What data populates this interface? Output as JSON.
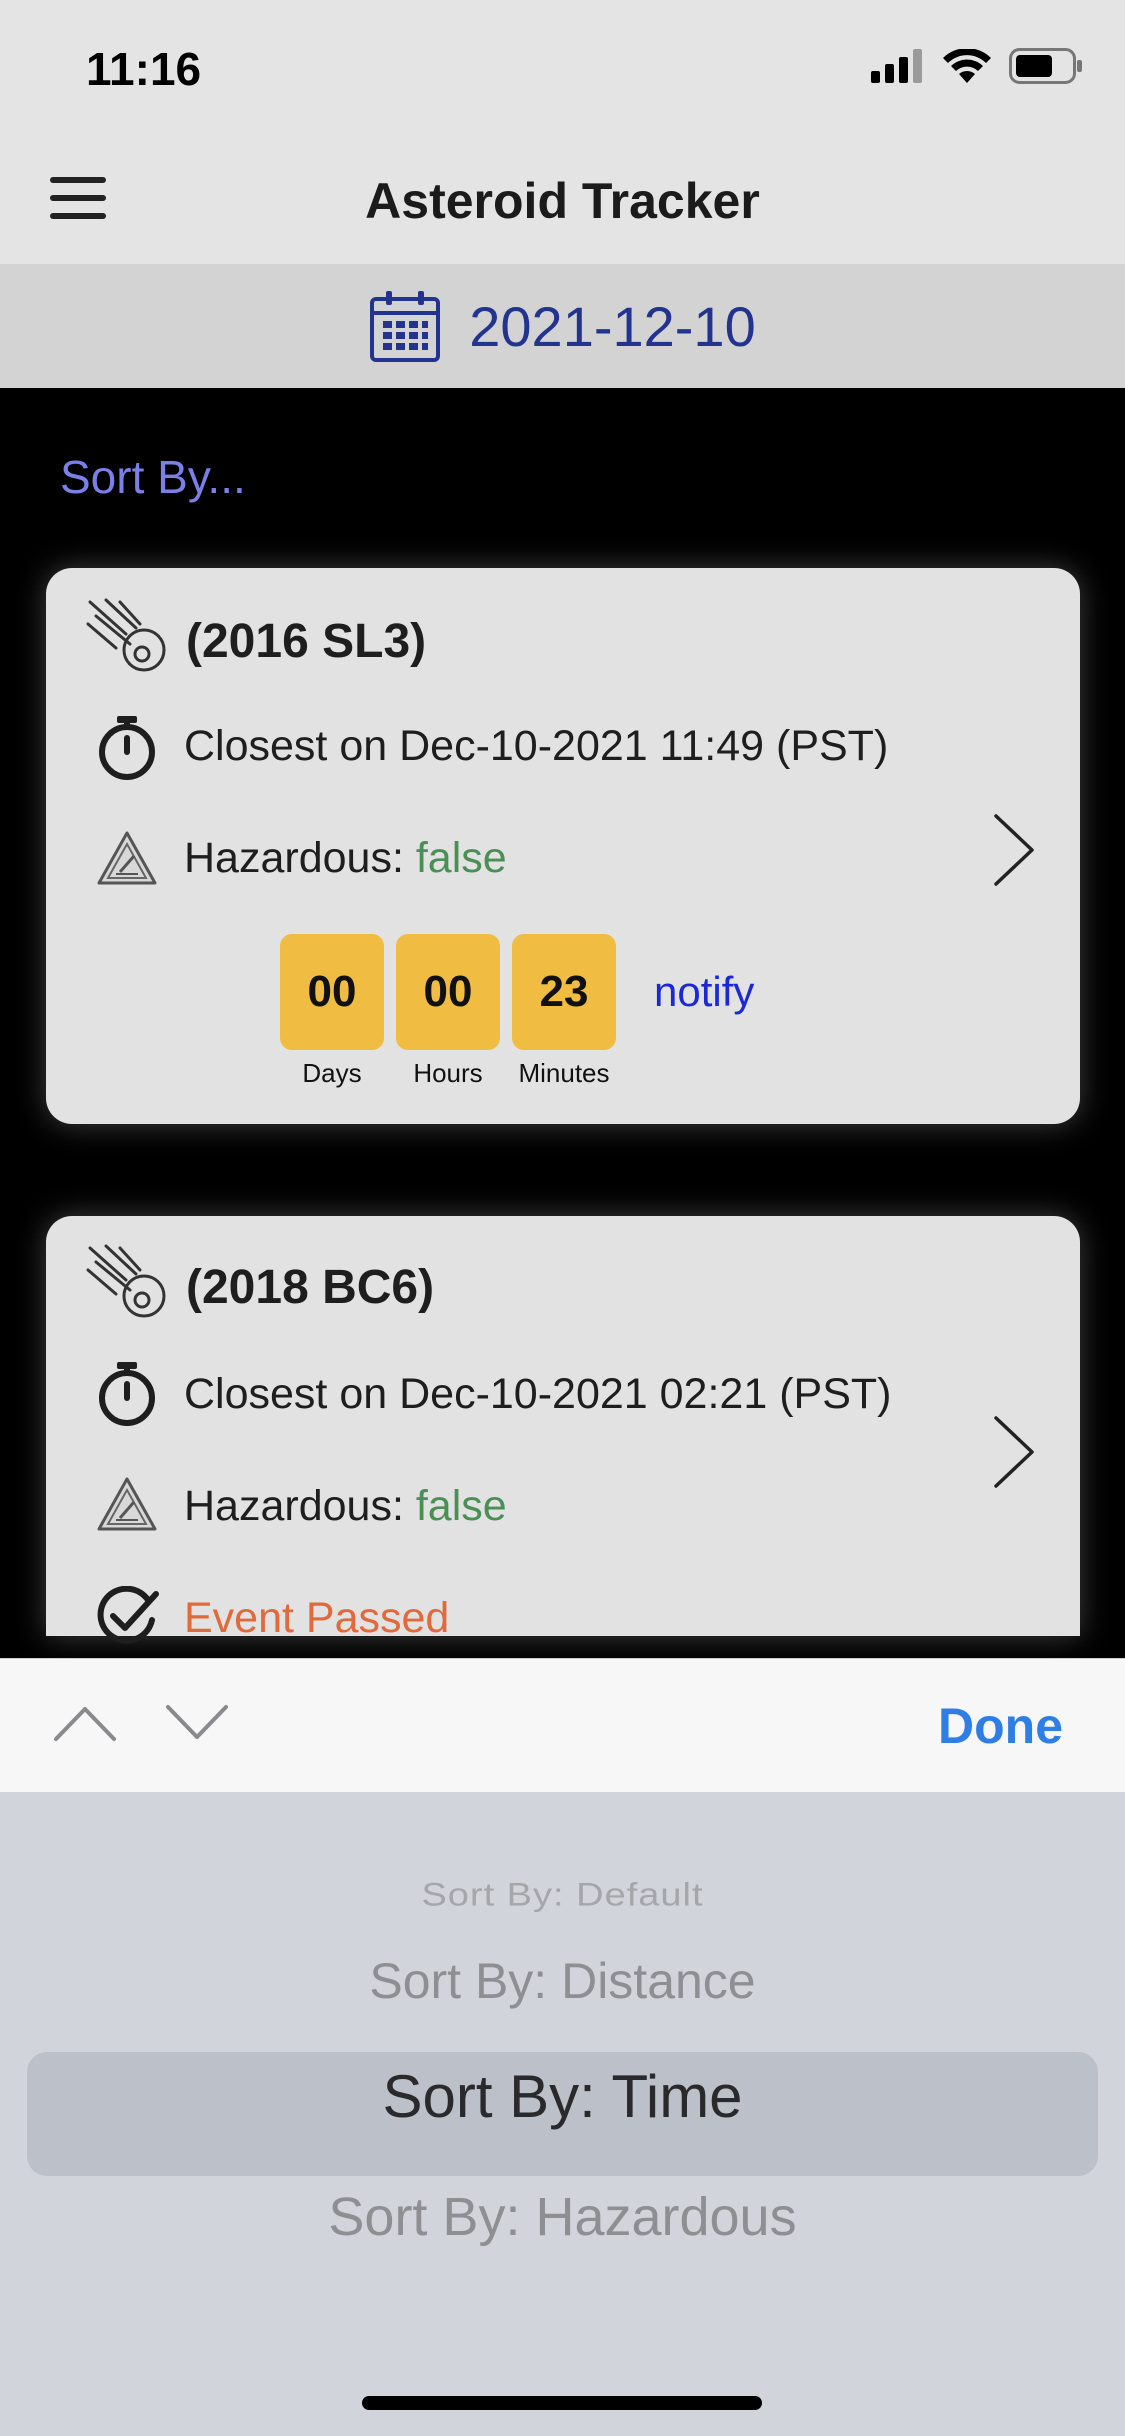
{
  "status_bar": {
    "time": "11:16",
    "icons": [
      "signal-icon",
      "wifi-icon",
      "battery-icon"
    ]
  },
  "nav": {
    "title": "Asteroid Tracker",
    "menu_icon": "hamburger-menu-icon"
  },
  "date_bar": {
    "date": "2021-12-10",
    "icon": "calendar-icon"
  },
  "sort_link": "Sort By...",
  "asteroids": [
    {
      "name": "(2016 SL3)",
      "closest": "Closest on Dec-10-2021 11:49 (PST)",
      "hazardous_label": "Hazardous:",
      "hazardous_value": "false",
      "countdown": {
        "days": "00",
        "days_label": "Days",
        "hours": "00",
        "hours_label": "Hours",
        "minutes": "23",
        "minutes_label": "Minutes"
      },
      "notify": "notify"
    },
    {
      "name": "(2018 BC6)",
      "closest": "Closest on Dec-10-2021 02:21 (PST)",
      "hazardous_label": "Hazardous:",
      "hazardous_value": "false",
      "status": "Event Passed"
    }
  ],
  "toolbar": {
    "done": "Done"
  },
  "picker": {
    "options": [
      "Sort By: Default",
      "Sort By: Distance",
      "Sort By: Time",
      "Sort By: Hazardous"
    ],
    "selected": "Sort By: Time"
  },
  "colors": {
    "accent_blue": "#2f7ee6",
    "false_green": "#4a8f55",
    "passed_orange": "#e06a3c",
    "countdown_yellow": "#f0bd42",
    "date_navy": "#22348e",
    "sort_link": "#7a80e6"
  }
}
